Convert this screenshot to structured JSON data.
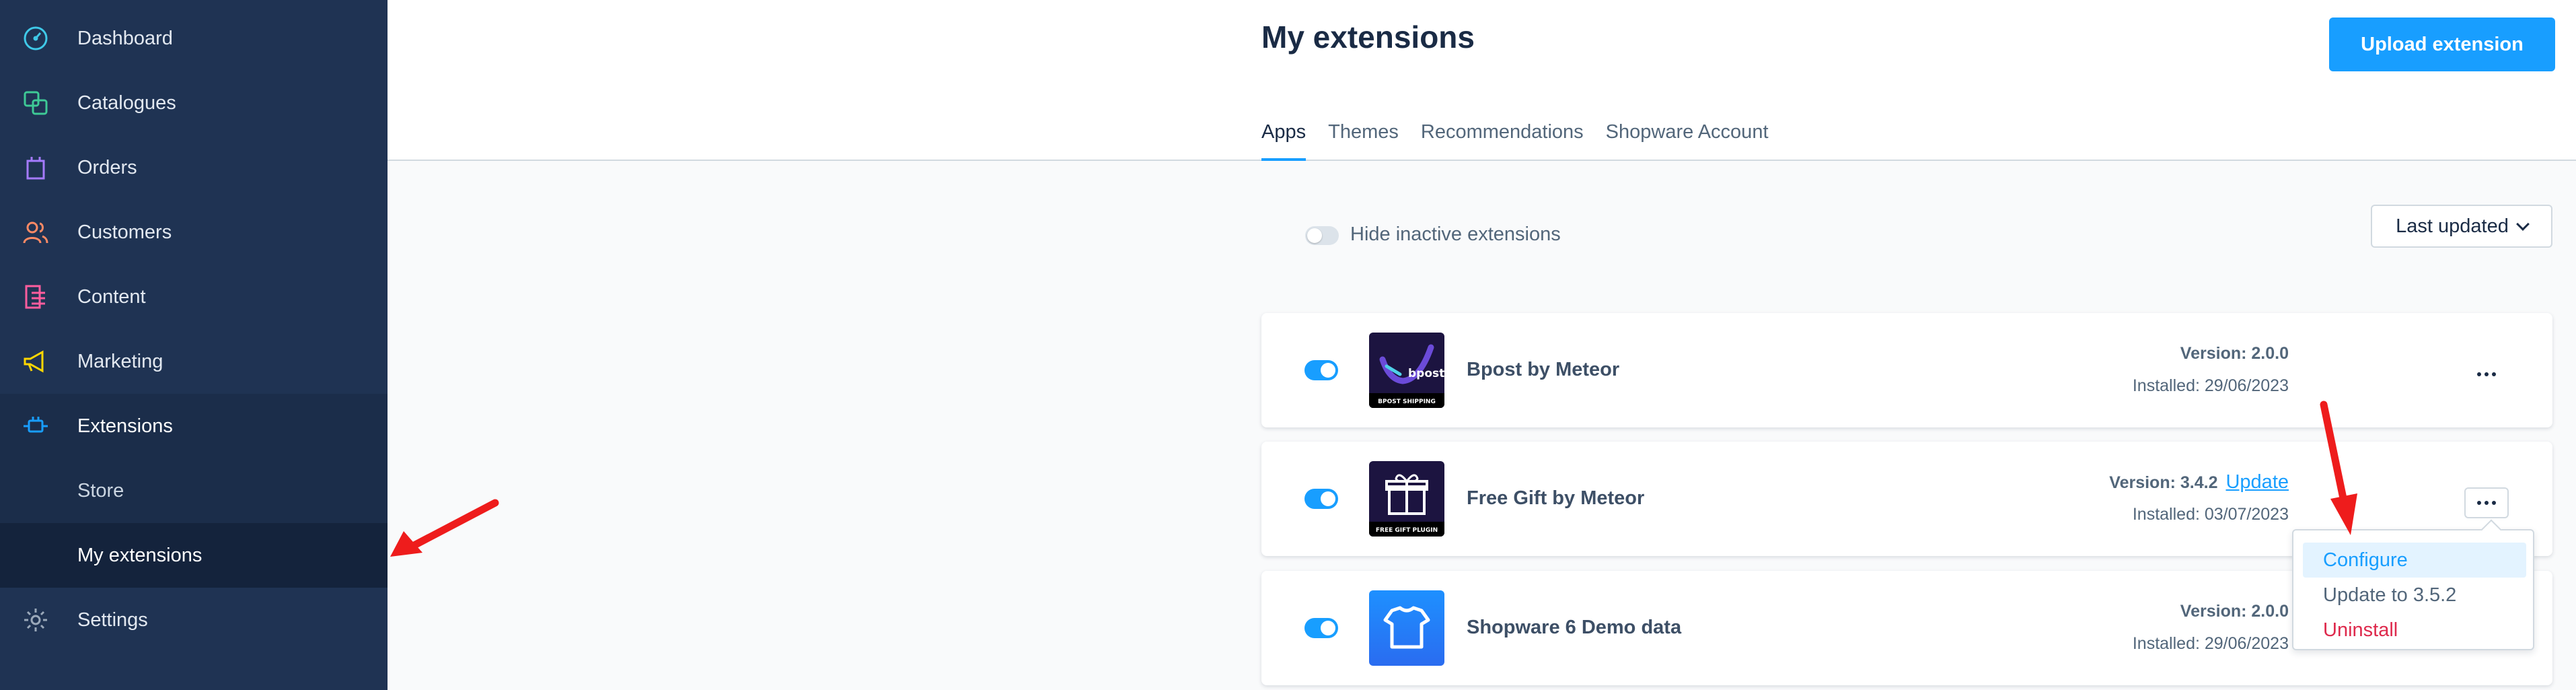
{
  "sidebar": {
    "items": [
      {
        "label": "Dashboard",
        "icon": "dashboard-icon",
        "color": "#3fc9e8"
      },
      {
        "label": "Catalogues",
        "icon": "catalogues-icon",
        "color": "#3ec996"
      },
      {
        "label": "Orders",
        "icon": "orders-icon",
        "color": "#a57bff"
      },
      {
        "label": "Customers",
        "icon": "customers-icon",
        "color": "#ff8a65"
      },
      {
        "label": "Content",
        "icon": "content-icon",
        "color": "#ff5d9e"
      },
      {
        "label": "Marketing",
        "icon": "marketing-icon",
        "color": "#ffd700"
      },
      {
        "label": "Extensions",
        "icon": "extensions-icon",
        "color": "#189eff"
      },
      {
        "label": "Settings",
        "icon": "settings-icon",
        "color": "#9aa8b9"
      }
    ],
    "sub_items": [
      {
        "label": "Store"
      },
      {
        "label": "My extensions"
      }
    ]
  },
  "header": {
    "title": "My extensions",
    "upload_label": "Upload extension",
    "tabs": [
      {
        "label": "Apps"
      },
      {
        "label": "Themes"
      },
      {
        "label": "Recommendations"
      },
      {
        "label": "Shopware Account"
      }
    ]
  },
  "filters": {
    "hide_inactive_label": "Hide inactive extensions",
    "sort_label": "Last updated"
  },
  "extensions": [
    {
      "name": "Bpost by Meteor",
      "version": "Version: 2.0.0",
      "installed": "Installed: 29/06/2023",
      "logo_text": "bpost",
      "logo_caption": "BPOST SHIPPING"
    },
    {
      "name": "Free Gift by Meteor",
      "version": "Version: 3.4.2",
      "update_label": "Update",
      "installed": "Installed: 03/07/2023",
      "logo_caption": "FREE GIFT PLUGIN"
    },
    {
      "name": "Shopware 6 Demo data",
      "version": "Version: 2.0.0",
      "installed": "Installed: 29/06/2023"
    }
  ],
  "context_menu": {
    "items": [
      {
        "label": "Configure"
      },
      {
        "label": "Update to 3.5.2"
      },
      {
        "label": "Uninstall"
      }
    ]
  },
  "colors": {
    "accent": "#189eff",
    "sidebar_bg": "#1f3353",
    "danger": "#de294c"
  }
}
